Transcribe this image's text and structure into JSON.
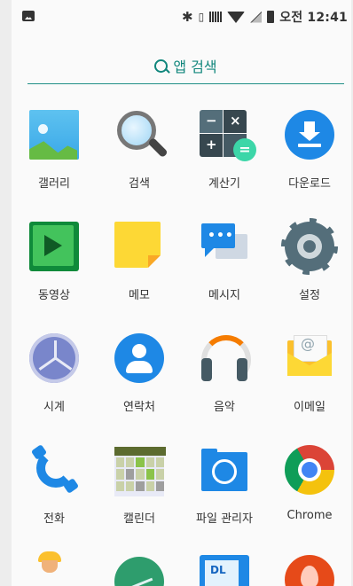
{
  "status_bar": {
    "time": "오전 12:41"
  },
  "search": {
    "label": "앱 검색",
    "accent_color": "#10867c"
  },
  "apps": [
    {
      "label": "갤러리",
      "icon": "gallery-icon"
    },
    {
      "label": "검색",
      "icon": "search-app-icon"
    },
    {
      "label": "계산기",
      "icon": "calculator-icon"
    },
    {
      "label": "다운로드",
      "icon": "download-icon"
    },
    {
      "label": "동영상",
      "icon": "video-icon"
    },
    {
      "label": "메모",
      "icon": "memo-icon"
    },
    {
      "label": "메시지",
      "icon": "message-icon"
    },
    {
      "label": "설정",
      "icon": "settings-icon"
    },
    {
      "label": "시계",
      "icon": "clock-icon"
    },
    {
      "label": "연락처",
      "icon": "contacts-icon"
    },
    {
      "label": "음악",
      "icon": "music-icon"
    },
    {
      "label": "이메일",
      "icon": "email-icon"
    },
    {
      "label": "전화",
      "icon": "phone-icon"
    },
    {
      "label": "캘린더",
      "icon": "calendar-icon"
    },
    {
      "label": "파일 관리자",
      "icon": "file-manager-icon"
    },
    {
      "label": "Chrome",
      "icon": "chrome-icon"
    }
  ],
  "partial_row": [
    {
      "icon": "worker-app-icon"
    },
    {
      "icon": "chart-app-icon"
    },
    {
      "icon": "dl-app-icon",
      "text": "DL"
    },
    {
      "icon": "fire-app-icon"
    }
  ]
}
